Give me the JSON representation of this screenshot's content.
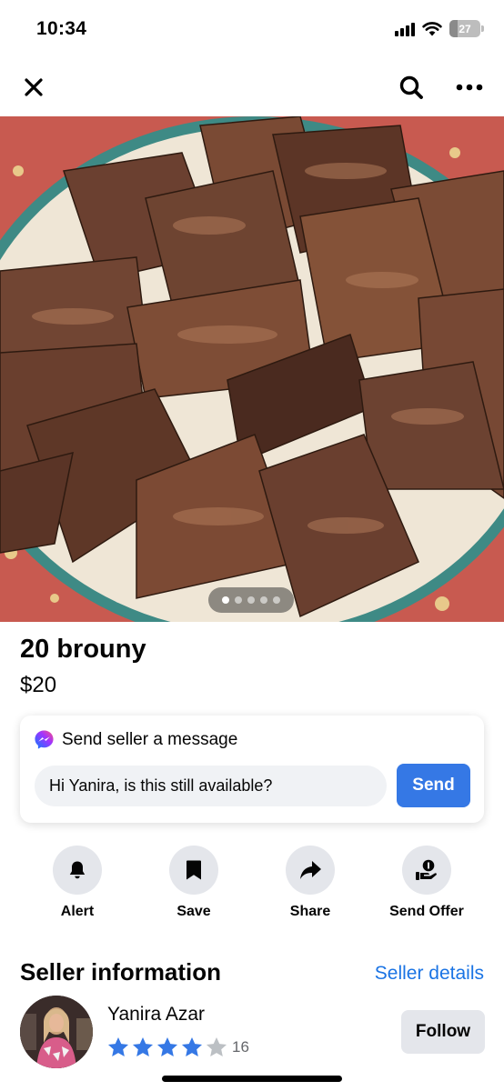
{
  "status_bar": {
    "time": "10:34",
    "battery_level": "27",
    "icons": [
      "cellular-signal-icon",
      "wifi-icon",
      "battery-icon"
    ]
  },
  "nav": {
    "icons": [
      "close-icon",
      "search-icon",
      "more-icon"
    ]
  },
  "photo": {
    "description_icon": "listing-photo",
    "photo_count": 5,
    "current_photo": 1
  },
  "listing": {
    "title": "20 brouny",
    "price": "$20"
  },
  "message": {
    "heading": "Send seller a message",
    "input_value": "Hi Yanira, is this still available?",
    "send_label": "Send",
    "icon": "messenger-icon"
  },
  "actions": [
    {
      "label": "Alert",
      "icon": "bell-icon"
    },
    {
      "label": "Save",
      "icon": "bookmark-icon"
    },
    {
      "label": "Share",
      "icon": "share-icon"
    },
    {
      "label": "Send Offer",
      "icon": "offer-icon"
    }
  ],
  "seller": {
    "heading": "Seller information",
    "details_link": "Seller details",
    "name": "Yanira Azar",
    "rating": 4,
    "rating_max": 5,
    "rating_count": "16",
    "follow_label": "Follow"
  },
  "colors": {
    "accent": "#3578e5",
    "link": "#1b74e4",
    "star": "#3578e5",
    "star_empty": "#bcc0c4",
    "button_gray": "#e4e6eb"
  }
}
